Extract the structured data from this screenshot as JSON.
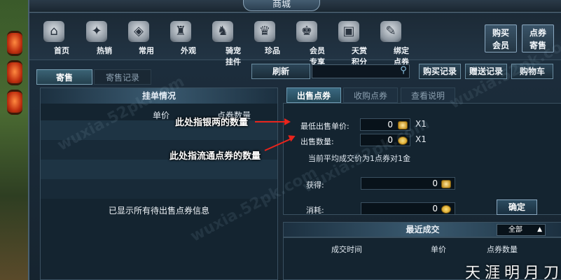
{
  "window": {
    "title": "商城"
  },
  "lanterns": [
    "",
    "",
    ""
  ],
  "categories": [
    {
      "label": "首页",
      "icon": "house-icon",
      "glyph": "⌂"
    },
    {
      "label": "热销",
      "icon": "star-icon",
      "glyph": "✦"
    },
    {
      "label": "常用",
      "icon": "bag-icon",
      "glyph": "◈"
    },
    {
      "label": "外观",
      "icon": "robe-icon",
      "glyph": "♜"
    },
    {
      "label": "骑宠挂件",
      "icon": "mount-icon",
      "glyph": "♞"
    },
    {
      "label": "珍品",
      "icon": "treasure-icon",
      "glyph": "♛"
    },
    {
      "label": "会员专享",
      "icon": "vip-icon",
      "glyph": "♚"
    },
    {
      "label": "天赏积分",
      "icon": "chest-icon",
      "glyph": "▣"
    },
    {
      "label": "绑定点券",
      "icon": "ticket-icon",
      "glyph": "✎"
    }
  ],
  "side_buttons": {
    "buy_member": "购买\n会员",
    "consign_tickets": "点券\n寄售"
  },
  "tabs": {
    "consign": "寄售",
    "consign_record": "寄售记录"
  },
  "actions": {
    "refresh": "刷新",
    "buy_record": "购买记录",
    "gift_record": "赠送记录",
    "cart": "购物车"
  },
  "search": {
    "value": ""
  },
  "left_panel": {
    "title": "挂单情况",
    "col_unit_price": "单价",
    "col_ticket_qty": "点券数量",
    "all_shown": "已显示所有待出售点券信息"
  },
  "right_tabs": {
    "sell": "出售点券",
    "buy": "收购点券",
    "help": "查看说明"
  },
  "sell_form": {
    "min_price_label": "最低出售单价:",
    "min_price_value": "0",
    "min_price_unit": "X1",
    "quantity_label": "出售数量:",
    "quantity_value": "0",
    "quantity_unit": "X1",
    "avg_note": "当前平均成交价为1点券对1金",
    "gain_label": "获得:",
    "gain_value": "0",
    "cost_label": "消耗:",
    "cost_value": "0",
    "confirm": "确定"
  },
  "recent": {
    "title": "最近成交",
    "filter": "全部",
    "col_time": "成交时间",
    "col_price": "单价",
    "col_qty": "点券数量"
  },
  "annotations": {
    "silver": "此处指银两的数量",
    "tickets": "此处指流通点券的数量"
  },
  "watermark": "wuxia.52pk.com",
  "game_logo": "天涯明月刀"
}
